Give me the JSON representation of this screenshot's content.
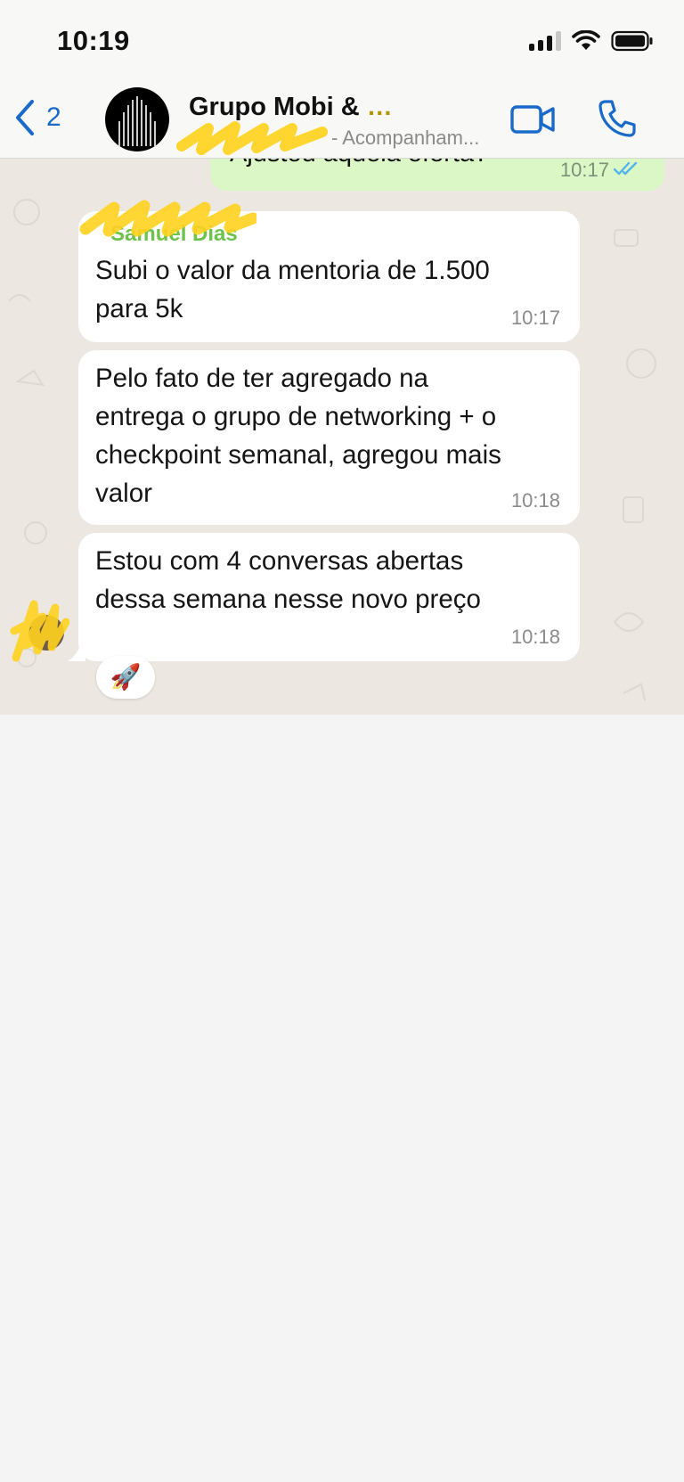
{
  "status_bar": {
    "time": "10:19"
  },
  "header": {
    "back_count": "2",
    "title": "Grupo Mobi &",
    "subtitle": "- Acompanham..."
  },
  "messages": {
    "outgoing": {
      "text": "Ajustou aquela oferta?",
      "time": "10:17"
    },
    "incoming": [
      {
        "sender": "Samuel Dias",
        "text": "Subi o valor da mentoria de 1.500\npara 5k",
        "time": "10:17"
      },
      {
        "text": "Pelo fato de ter agregado na\nentrega o grupo de networking + o\ncheckpoint semanal, agregou mais\nvalor",
        "time": "10:18"
      },
      {
        "text": "Estou com 4 conversas abertas\ndessa semana nesse novo preço",
        "time": "10:18"
      }
    ],
    "reaction": "🚀"
  },
  "colors": {
    "accent": "#1a6ac9",
    "outgoing_bubble": "#dcf7c6",
    "incoming_bubble": "#ffffff",
    "chat_background": "#ece8e1",
    "sender_name": "#6cc24a",
    "read_ticks": "#4fb6ec",
    "redaction": "#ffd21e"
  },
  "icons": [
    "back-chevron-icon",
    "video-call-icon",
    "phone-call-icon",
    "read-ticks-icon",
    "signal-icon",
    "wifi-icon",
    "battery-icon"
  ]
}
